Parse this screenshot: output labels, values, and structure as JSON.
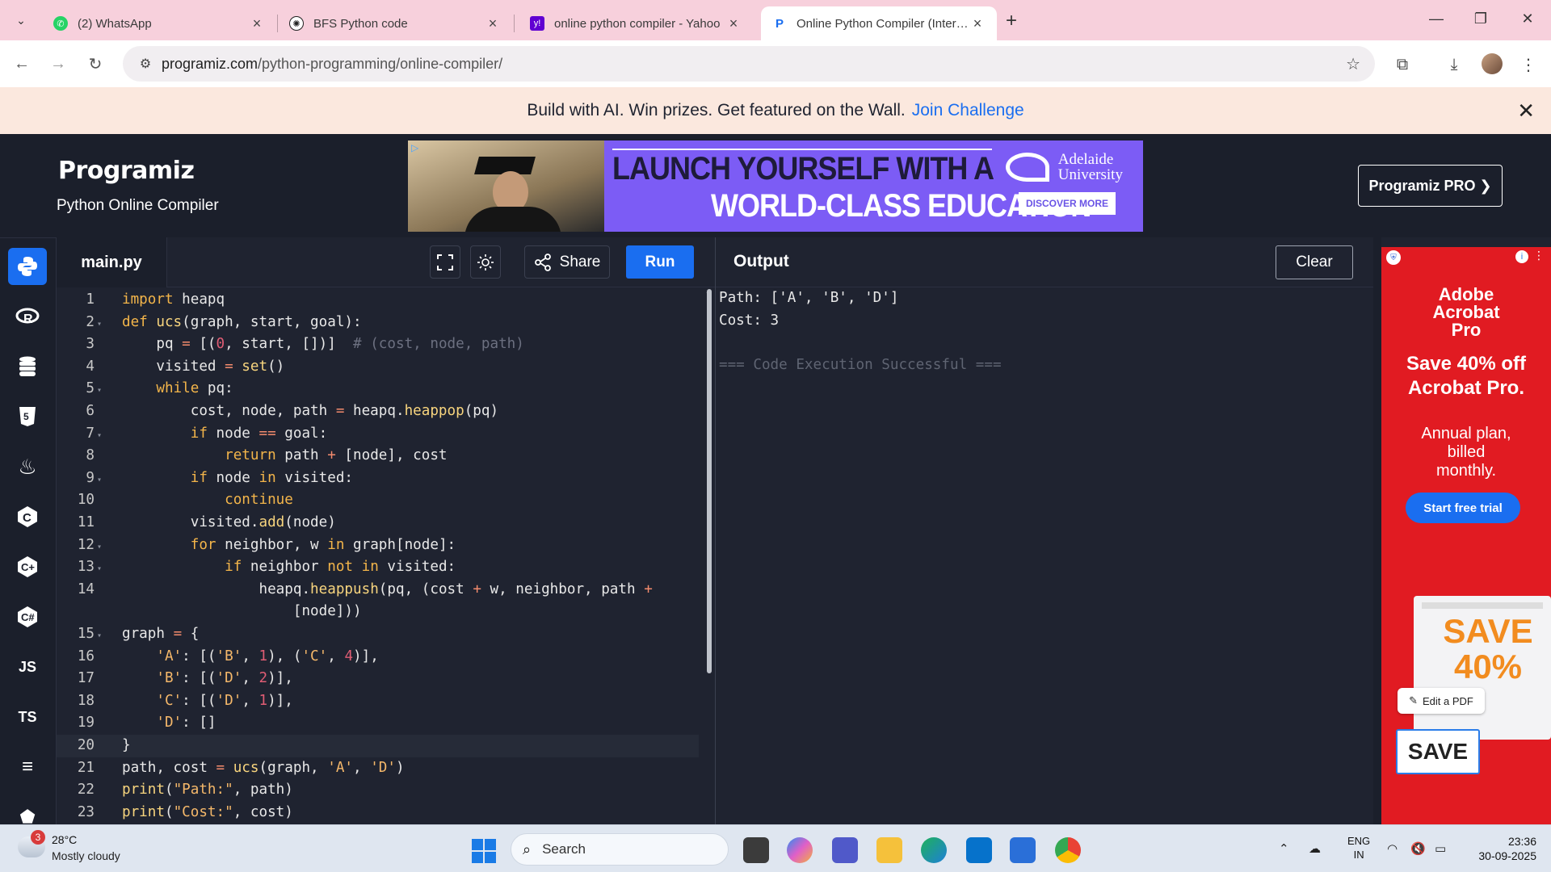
{
  "browser": {
    "tabs": [
      {
        "title": "(2) WhatsApp",
        "icon": "whatsapp-icon",
        "color": "#25d366"
      },
      {
        "title": "BFS Python code",
        "icon": "chatgpt-icon",
        "color": "#222222"
      },
      {
        "title": "online python compiler - Yahoo",
        "icon": "yahoo-icon",
        "color": "#6001d2"
      },
      {
        "title": "Online Python Compiler (Interpreter)",
        "icon": "programiz-icon",
        "color": "#1a6ef0"
      }
    ],
    "url_host": "programiz.com",
    "url_path": "/python-programming/online-compiler/"
  },
  "banner": {
    "text": "Build with AI. Win prizes. Get featured on the Wall.",
    "link": "Join Challenge"
  },
  "header": {
    "logo": "Programiz",
    "subtitle": "Python Online Compiler",
    "pro_button": "Programiz PRO ❯",
    "ad": {
      "line1": "LAUNCH YOURSELF WITH A",
      "line2": "WORLD-CLASS EDUCATION",
      "university": "Adelaide University",
      "cta": "DISCOVER MORE"
    }
  },
  "rail": {
    "items": [
      "python-icon",
      "r-icon",
      "sql-icon",
      "html-icon",
      "java-icon",
      "c-icon",
      "cpp-icon",
      "csharp-icon",
      "JS",
      "TS",
      "go-icon",
      "php-icon"
    ]
  },
  "editor": {
    "file": "main.py",
    "share_label": "Share",
    "run_label": "Run",
    "lines": [
      {
        "n": "1",
        "fold": false
      },
      {
        "n": "2",
        "fold": true
      },
      {
        "n": "3",
        "fold": false
      },
      {
        "n": "4",
        "fold": false
      },
      {
        "n": "5",
        "fold": true
      },
      {
        "n": "6",
        "fold": false
      },
      {
        "n": "7",
        "fold": true
      },
      {
        "n": "8",
        "fold": false
      },
      {
        "n": "9",
        "fold": true
      },
      {
        "n": "10",
        "fold": false
      },
      {
        "n": "11",
        "fold": false
      },
      {
        "n": "12",
        "fold": true
      },
      {
        "n": "13",
        "fold": true
      },
      {
        "n": "14",
        "fold": false
      },
      {
        "n": "",
        "fold": false
      },
      {
        "n": "15",
        "fold": true
      },
      {
        "n": "16",
        "fold": false
      },
      {
        "n": "17",
        "fold": false
      },
      {
        "n": "18",
        "fold": false
      },
      {
        "n": "19",
        "fold": false
      },
      {
        "n": "20",
        "fold": false
      },
      {
        "n": "21",
        "fold": false
      },
      {
        "n": "22",
        "fold": false
      },
      {
        "n": "23",
        "fold": false
      }
    ],
    "code": [
      "import heapq",
      "def ucs(graph, start, goal):",
      "    pq = [(0, start, [])]  # (cost, node, path)",
      "    visited = set()",
      "    while pq:",
      "        cost, node, path = heapq.heappop(pq)",
      "        if node == goal:",
      "            return path + [node], cost",
      "        if node in visited:",
      "            continue",
      "        visited.add(node)",
      "        for neighbor, w in graph[node]:",
      "            if neighbor not in visited:",
      "                heapq.heappush(pq, (cost + w, neighbor, path +",
      "                    [node]))",
      "graph = {",
      "    'A': [('B', 1), ('C', 4)],",
      "    'B': [('D', 2)],",
      "    'C': [('D', 1)],",
      "    'D': []",
      "}",
      "path, cost = ucs(graph, 'A', 'D')",
      "print(\"Path:\", path)",
      "print(\"Cost:\", cost)"
    ]
  },
  "output": {
    "title": "Output",
    "clear_label": "Clear",
    "lines": [
      "Path: ['A', 'B', 'D']",
      "Cost: 3",
      "",
      "=== Code Execution Successful ==="
    ]
  },
  "side_ad": {
    "brand": "Adobe Acrobat Pro",
    "headline": "Save 40% off Acrobat Pro.",
    "sub": "Annual plan, billed monthly.",
    "cta": "Start free trial",
    "promo": "SAVE 40%",
    "edit": "Edit a PDF",
    "save": "SAVE"
  },
  "taskbar": {
    "badge": "3",
    "temp": "28°C",
    "weather": "Mostly cloudy",
    "search": "Search",
    "lang1": "ENG",
    "lang2": "IN",
    "time": "23:36",
    "date": "30-09-2025"
  }
}
